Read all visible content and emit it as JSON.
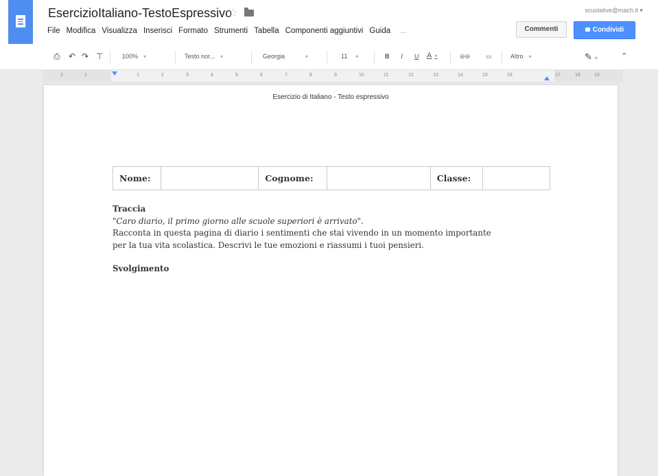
{
  "app": {
    "doc_title": "EsercizioItaliano-TestoEspressivo",
    "user_email": "scuolalive@mach.it ▾"
  },
  "menu": [
    "File",
    "Modifica",
    "Visualizza",
    "Inserisci",
    "Formato",
    "Strumenti",
    "Tabella",
    "Componenti aggiuntivi",
    "Guida",
    "..."
  ],
  "buttons": {
    "comments": "Commenti",
    "share": "Condividi"
  },
  "toolbar": {
    "zoom": "100%",
    "style": "Testo nor...",
    "font": "Georgia",
    "size": "11",
    "bold": "B",
    "italic": "I",
    "underline": "U",
    "text_color": "A",
    "more": "Altro"
  },
  "ruler": [
    "2",
    "1",
    "1",
    "2",
    "3",
    "4",
    "5",
    "6",
    "7",
    "8",
    "9",
    "10",
    "11",
    "12",
    "13",
    "14",
    "15",
    "16",
    "17",
    "18",
    "19"
  ],
  "document": {
    "header": "Esercizio di Italiano - Testo espressivo",
    "table": {
      "nome": "Nome:",
      "cognome": "Cognome:",
      "classe": "Classe:"
    },
    "traccia_heading": "Traccia",
    "quote": "\"Caro diario, il primo giorno alle scuole superiori è arrivato\".",
    "instruction_line1": "Racconta in questa pagina di diario i sentimenti che stai vivendo in un momento importante",
    "instruction_line2": "per la tua vita scolastica. Descrivi le tue emozioni e riassumi i tuoi pensieri.",
    "svolgimento_heading": "Svolgimento"
  }
}
